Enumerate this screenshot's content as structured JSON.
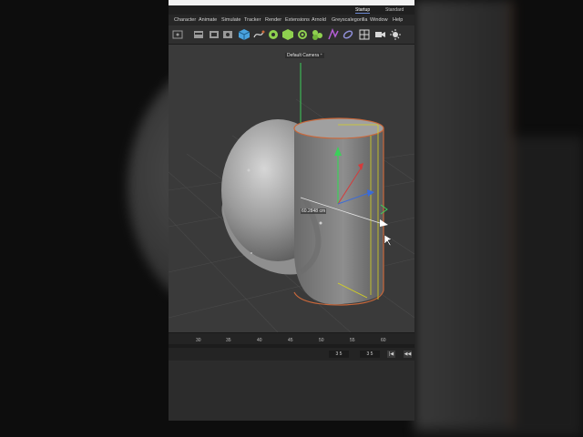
{
  "layouts": {
    "active": "Startup",
    "other": "Standard"
  },
  "menu": {
    "items": [
      "Character",
      "Animate",
      "Simulate",
      "Tracker",
      "Render",
      "Extensions",
      "Arnold",
      "Greyscalegorilla",
      "Window",
      "Help"
    ]
  },
  "toolbar": {
    "tools": [
      {
        "icon": "render-region-icon",
        "color": "#9a9a9a"
      },
      {
        "icon": "render-view-icon",
        "color": "#9a9a9a"
      },
      {
        "icon": "render-picture-viewer-icon",
        "color": "#9a9a9a"
      },
      {
        "icon": "render-settings-icon",
        "color": "#9a9a9a"
      },
      {
        "icon": "cube-icon",
        "color": "#4aa3df"
      },
      {
        "icon": "spline-pen-icon",
        "color": "#8fd14f"
      },
      {
        "icon": "subdivision-icon",
        "color": "#8fd14f"
      },
      {
        "icon": "generator-cube-icon",
        "color": "#8fd14f"
      },
      {
        "icon": "deformer-icon",
        "color": "#8fd14f"
      },
      {
        "icon": "cloner-icon",
        "color": "#8fd14f"
      },
      {
        "icon": "field-icon",
        "color": "#b45dd6"
      },
      {
        "icon": "scene-ring-icon",
        "color": "#8f8fd9"
      },
      {
        "icon": "grid-layout-icon",
        "color": "#d9d9d9"
      },
      {
        "icon": "camera-icon",
        "color": "#d9d9d9"
      },
      {
        "icon": "light-icon",
        "color": "#d9d9d9"
      }
    ]
  },
  "viewport": {
    "camera_label": "Default Camera ⁺",
    "measure_readout": "60.2848 cm",
    "colors": {
      "selection_edge": "#c9683b",
      "axis_y": "#3ccf5a",
      "axis_x": "#d43b3b",
      "axis_z": "#3a6bd9",
      "bbox": "#d6d21f"
    }
  },
  "timeline": {
    "ticks": [
      "30",
      "35",
      "40",
      "45",
      "50",
      "55",
      "60"
    ],
    "current_frame": "3 5",
    "end_frame": "3 5"
  }
}
